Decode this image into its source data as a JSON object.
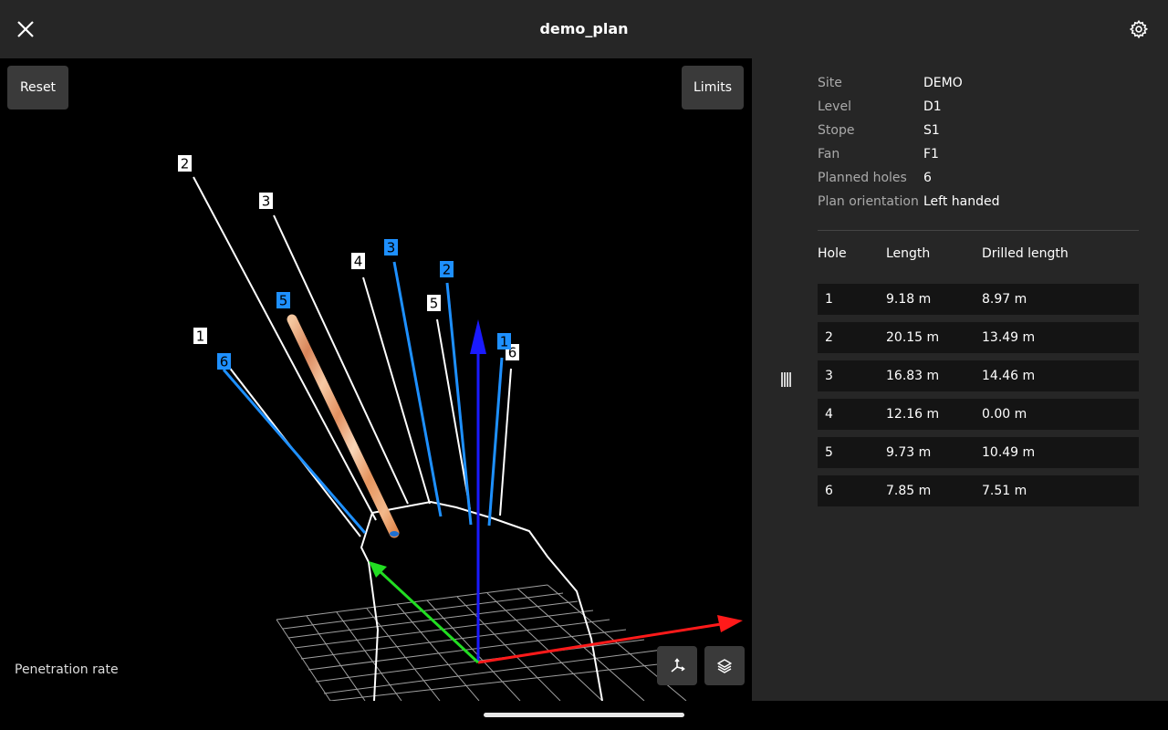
{
  "header": {
    "title": "demo_plan"
  },
  "viewport": {
    "reset_label": "Reset",
    "limits_label": "Limits",
    "legend_label": "Penetration rate",
    "planned_hole_labels": [
      "1",
      "2",
      "3",
      "4",
      "5",
      "6"
    ],
    "drilled_hole_labels": [
      "1",
      "2",
      "3",
      "5",
      "6"
    ],
    "colors": {
      "planned": "#ffffff",
      "drilled": "#1e90ff",
      "x_axis": "#ff1a1a",
      "y_axis": "#22dd22",
      "z_axis": "#1a1aff",
      "penetration": "#f0a070"
    }
  },
  "info": {
    "rows": [
      {
        "key": "Site",
        "value": "DEMO"
      },
      {
        "key": "Level",
        "value": "D1"
      },
      {
        "key": "Stope",
        "value": "S1"
      },
      {
        "key": "Fan",
        "value": "F1"
      },
      {
        "key": "Planned holes",
        "value": "6"
      },
      {
        "key": "Plan orientation",
        "value": "Left handed"
      }
    ]
  },
  "table": {
    "headers": [
      "Hole",
      "Length",
      "Drilled length"
    ],
    "rows": [
      [
        "1",
        "9.18 m",
        "8.97 m"
      ],
      [
        "2",
        "20.15 m",
        "13.49 m"
      ],
      [
        "3",
        "16.83 m",
        "14.46 m"
      ],
      [
        "4",
        "12.16 m",
        "0.00 m"
      ],
      [
        "5",
        "9.73 m",
        "10.49 m"
      ],
      [
        "6",
        "7.85 m",
        "7.51 m"
      ]
    ]
  },
  "icons": {
    "close": "close-icon",
    "settings": "gear-icon",
    "axes": "axes-icon",
    "layers": "layers-icon",
    "handle": "drag-handle-icon"
  }
}
